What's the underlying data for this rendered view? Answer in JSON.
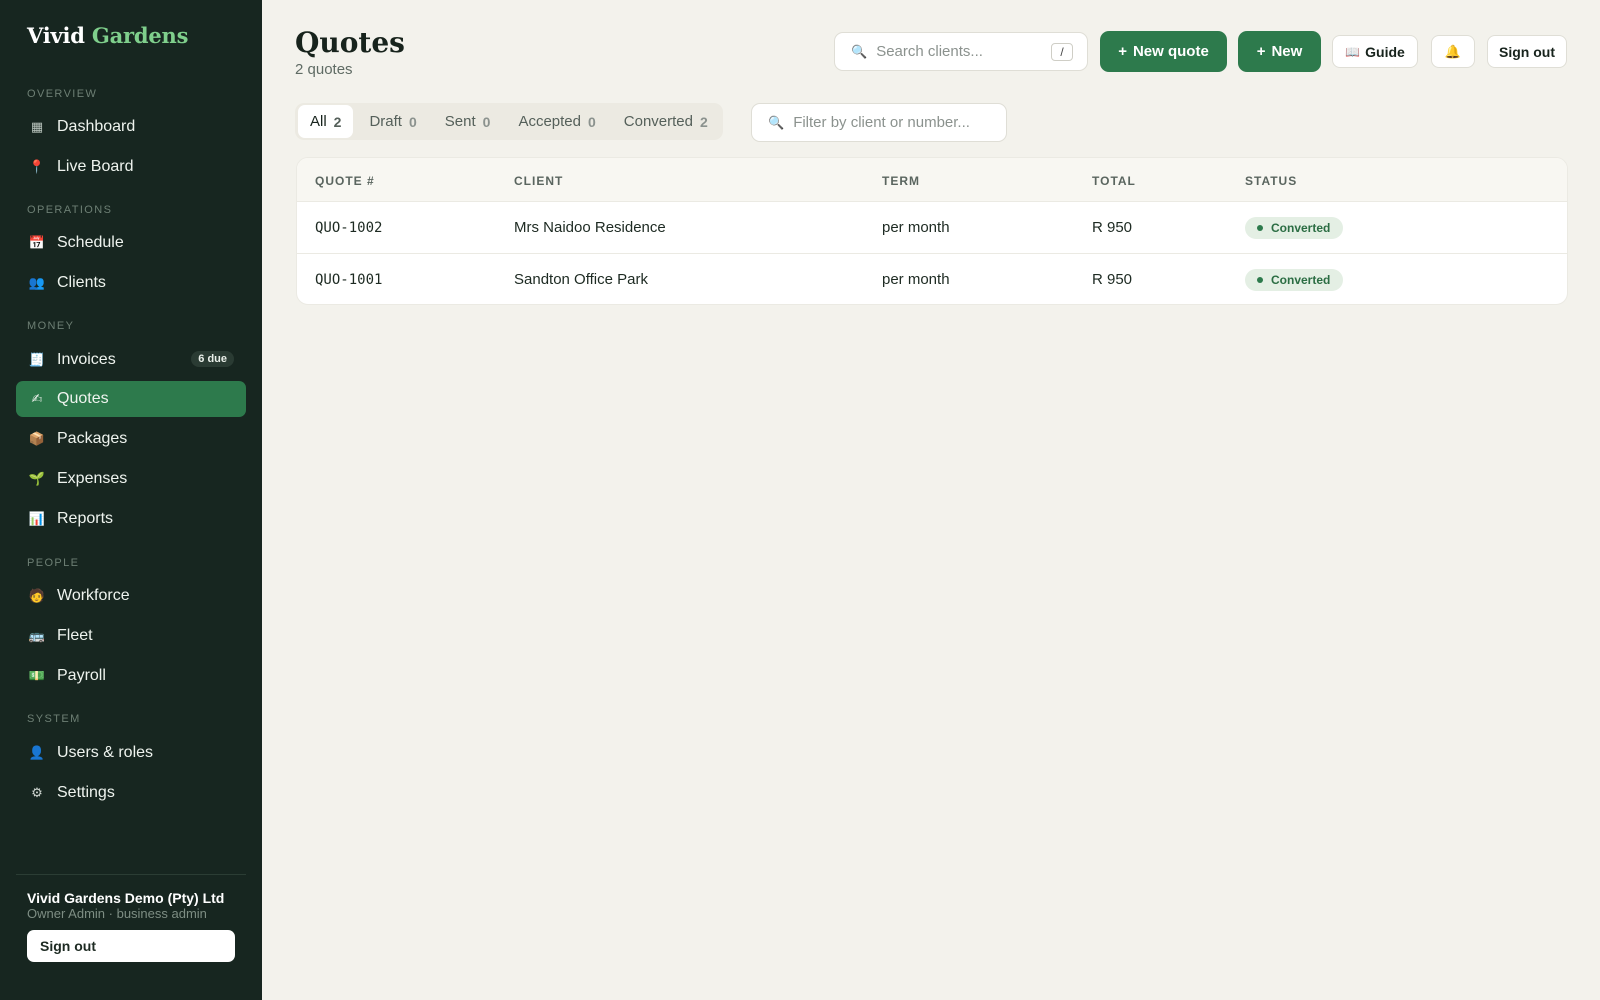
{
  "brand": {
    "name": "Vivid",
    "accent": "Gardens"
  },
  "sidebar": {
    "sections": {
      "overview": "OVERVIEW",
      "operations": "OPERATIONS",
      "money": "MONEY",
      "people": "PEOPLE",
      "system": "SYSTEM"
    },
    "items": [
      {
        "label": "Dashboard",
        "icon": "grid-icon",
        "glyph": "▦"
      },
      {
        "label": "Live Board",
        "icon": "pin-icon",
        "glyph": "📍"
      },
      {
        "label": "Schedule",
        "icon": "calendar-icon",
        "glyph": "📅"
      },
      {
        "label": "Clients",
        "icon": "people-icon",
        "glyph": "👥"
      },
      {
        "label": "Invoices",
        "icon": "receipt-icon",
        "glyph": "🧾",
        "badge": "6 due"
      },
      {
        "label": "Quotes",
        "icon": "writing-hand-icon",
        "glyph": "✍",
        "active": true
      },
      {
        "label": "Packages",
        "icon": "package-icon",
        "glyph": "📦"
      },
      {
        "label": "Expenses",
        "icon": "seedling-icon",
        "glyph": "🌱"
      },
      {
        "label": "Reports",
        "icon": "chart-icon",
        "glyph": "📊"
      },
      {
        "label": "Workforce",
        "icon": "worker-icon",
        "glyph": "🧑"
      },
      {
        "label": "Fleet",
        "icon": "bus-icon",
        "glyph": "🚌"
      },
      {
        "label": "Payroll",
        "icon": "money-icon",
        "glyph": "💵"
      },
      {
        "label": "Users & roles",
        "icon": "user-icon",
        "glyph": "👤"
      },
      {
        "label": "Settings",
        "icon": "gear-icon",
        "glyph": "⚙"
      }
    ],
    "org_name": "Vivid Gardens Demo (Pty) Ltd",
    "org_role": "Owner Admin · business admin",
    "signout_label": "Sign out"
  },
  "header": {
    "title": "Quotes",
    "subtitle": "2 quotes",
    "search_placeholder": "Search clients...",
    "search_shortcut": "/",
    "new_quote_label": "New quote",
    "new_label": "New",
    "guide_label": "Guide",
    "signout_label": "Sign out"
  },
  "tabs": [
    {
      "label": "All",
      "count": "2",
      "active": true
    },
    {
      "label": "Draft",
      "count": "0"
    },
    {
      "label": "Sent",
      "count": "0"
    },
    {
      "label": "Accepted",
      "count": "0"
    },
    {
      "label": "Converted",
      "count": "2"
    }
  ],
  "filter": {
    "placeholder": "Filter by client or number..."
  },
  "table": {
    "columns": [
      "QUOTE #",
      "CLIENT",
      "TERM",
      "TOTAL",
      "STATUS"
    ],
    "rows": [
      {
        "number": "QUO-1002",
        "client": "Mrs Naidoo Residence",
        "term": "per month",
        "total": "R 950",
        "status": "Converted"
      },
      {
        "number": "QUO-1001",
        "client": "Sandton Office Park",
        "term": "per month",
        "total": "R 950",
        "status": "Converted"
      }
    ]
  },
  "colors": {
    "sidebar_bg": "#172620",
    "accent_green": "#2d7a4c",
    "brand_accent": "#7fcf8c",
    "page_bg": "#f3f2ec"
  }
}
